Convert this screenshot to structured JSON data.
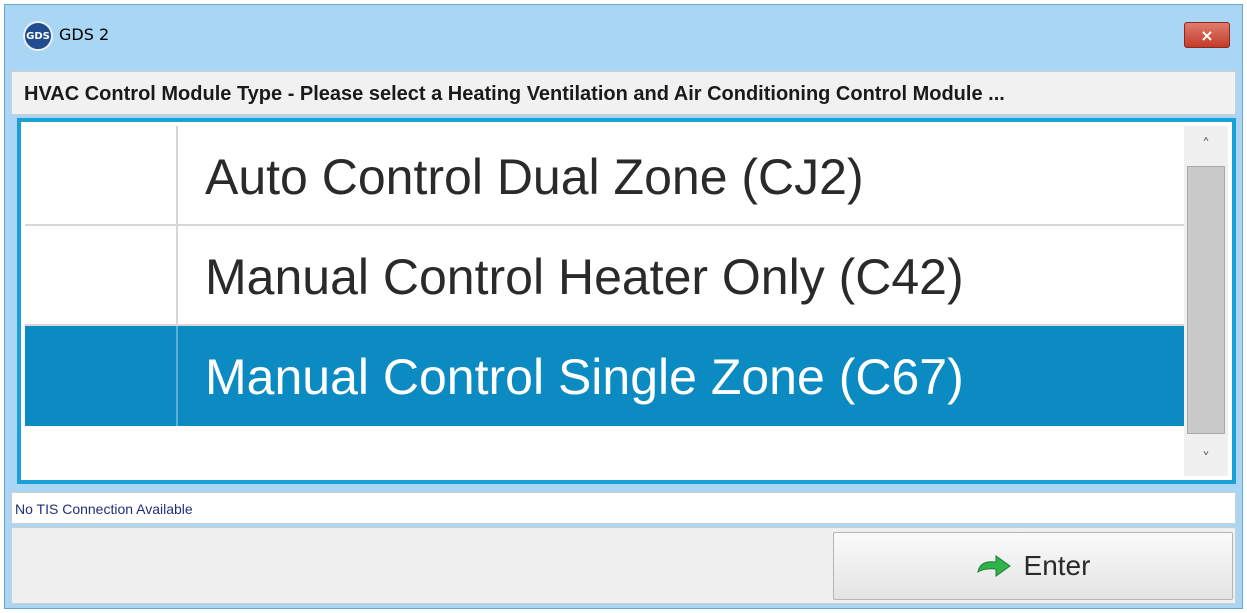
{
  "window": {
    "title": "GDS 2",
    "logo_text": "GDS",
    "close_glyph": "×"
  },
  "header": {
    "text": "HVAC Control Module Type - Please select a Heating Ventilation and Air Conditioning Control Module ..."
  },
  "list": {
    "items": [
      {
        "label": "Auto Control Dual Zone (CJ2)",
        "selected": false
      },
      {
        "label": "Manual Control Heater Only (C42)",
        "selected": false
      },
      {
        "label": "Manual Control Single Zone (C67)",
        "selected": true
      }
    ],
    "scroll_up_glyph": "˄",
    "scroll_down_glyph": "˅"
  },
  "status": {
    "text": "No TIS Connection Available"
  },
  "footer": {
    "enter_label": "Enter",
    "enter_icon": "green-arrow-icon"
  },
  "colors": {
    "selection": "#0b8bc2",
    "frame_accent": "#1d9fd8",
    "window_bg": "#a9d6f5",
    "close_button": "#c23c2a",
    "enter_arrow": "#2fb34a"
  }
}
